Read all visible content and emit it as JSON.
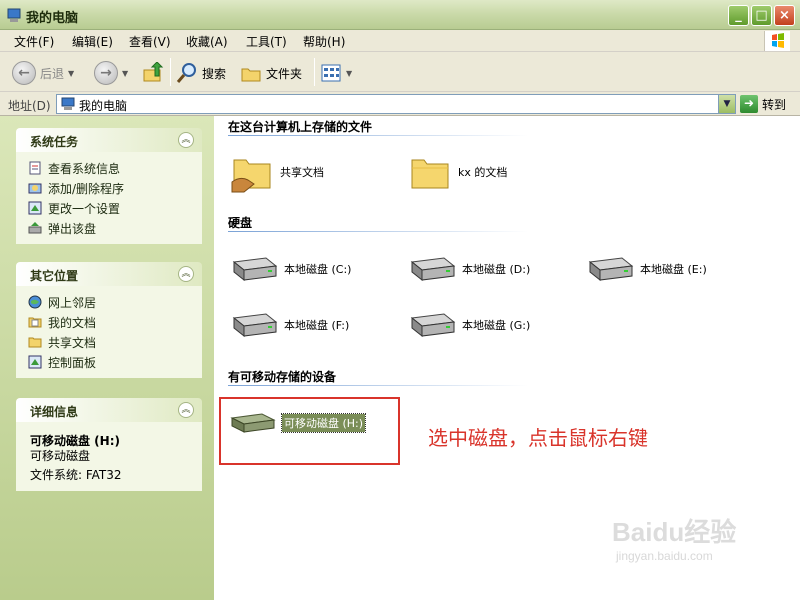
{
  "window": {
    "title": "我的电脑"
  },
  "menu": [
    "文件(F)",
    "编辑(E)",
    "查看(V)",
    "收藏(A)",
    "工具(T)",
    "帮助(H)"
  ],
  "toolbar": {
    "back_label": "后退",
    "search_label": "搜索",
    "folders_label": "文件夹"
  },
  "address": {
    "label": "地址(D)",
    "value": "我的电脑",
    "go_label": "转到"
  },
  "sidebar": {
    "system_tasks": {
      "title": "系统任务",
      "items": [
        "查看系统信息",
        "添加/删除程序",
        "更改一个设置",
        "弹出该盘"
      ]
    },
    "other_places": {
      "title": "其它位置",
      "items": [
        "网上邻居",
        "我的文档",
        "共享文档",
        "控制面板"
      ]
    },
    "details": {
      "title": "详细信息",
      "name": "可移动磁盘 (H:)",
      "type": "可移动磁盘",
      "filesystem": "文件系统: FAT32"
    }
  },
  "main": {
    "files_group": {
      "title": "在这台计算机上存储的文件",
      "items": [
        "共享文档",
        "kx 的文档"
      ]
    },
    "disks_group": {
      "title": "硬盘",
      "items": [
        "本地磁盘 (C:)",
        "本地磁盘 (D:)",
        "本地磁盘 (E:)",
        "本地磁盘 (F:)",
        "本地磁盘 (G:)"
      ]
    },
    "removable_group": {
      "title": "有可移动存储的设备",
      "items": [
        "可移动磁盘 (H:)"
      ]
    }
  },
  "annotation": "选中磁盘，点击鼠标右键",
  "watermark": {
    "logo": "Baidu经验",
    "url": "jingyan.baidu.com"
  },
  "colors": {
    "annotation": "#d9342b",
    "selection": "#7b8e58"
  }
}
